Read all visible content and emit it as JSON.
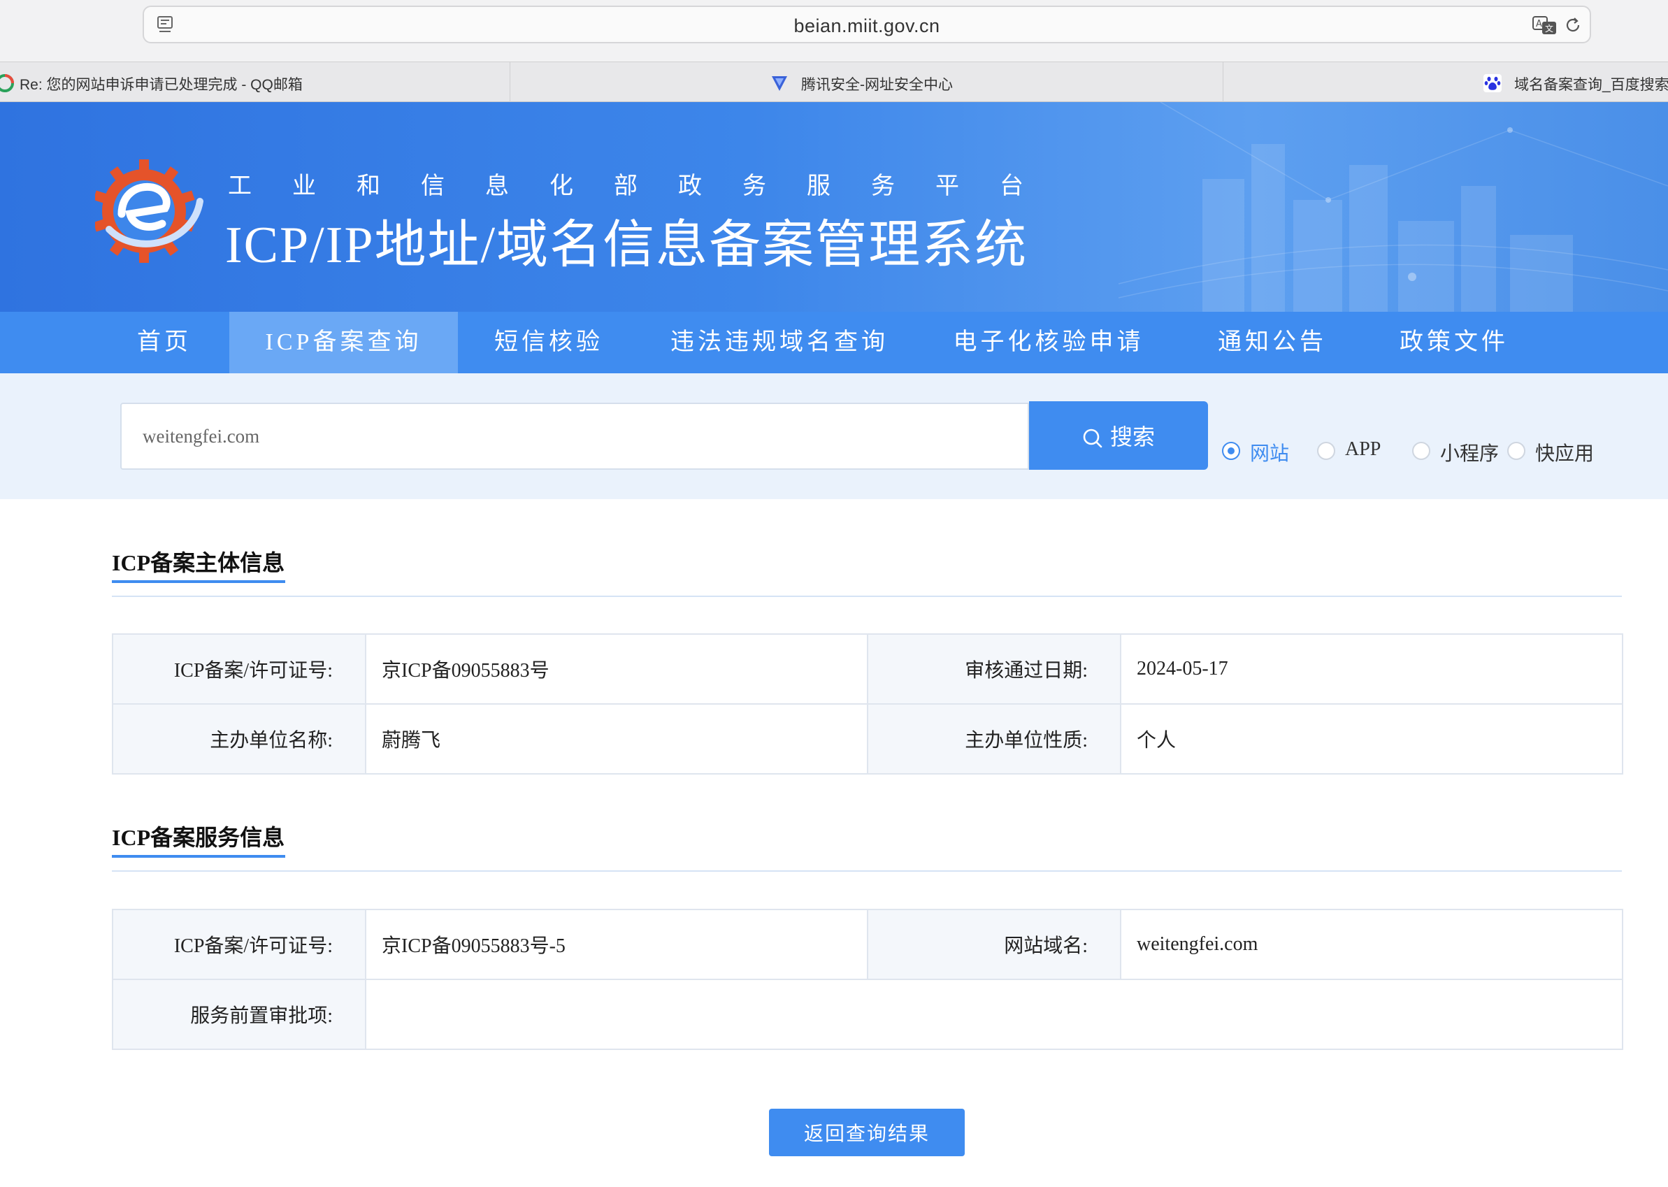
{
  "browser": {
    "address": "beian.miit.gov.cn",
    "tabs": [
      {
        "label": "Re: 您的网站申诉申请已处理完成 - QQ邮箱"
      },
      {
        "label": "腾讯安全-网址安全中心"
      },
      {
        "label": "域名备案查询_百度搜索"
      }
    ]
  },
  "header": {
    "ministry": "工业和信息化部政务服务平台",
    "system": "ICP/IP地址/域名信息备案管理系统"
  },
  "nav": {
    "items": [
      {
        "label": "首页"
      },
      {
        "label": "ICP备案查询"
      },
      {
        "label": "短信核验"
      },
      {
        "label": "违法违规域名查询"
      },
      {
        "label": "电子化核验申请"
      },
      {
        "label": "通知公告"
      },
      {
        "label": "政策文件"
      }
    ],
    "active_index": 1
  },
  "search": {
    "value": "weitengfei.com",
    "button_label": "搜索",
    "types": [
      {
        "label": "网站",
        "checked": true
      },
      {
        "label": "APP",
        "checked": false
      },
      {
        "label": "小程序",
        "checked": false
      },
      {
        "label": "快应用",
        "checked": false
      }
    ]
  },
  "subject_section": {
    "title": "ICP备案主体信息",
    "rows": [
      {
        "label1": "ICP备案/许可证号:",
        "value1": "京ICP备09055883号",
        "label2": "审核通过日期:",
        "value2": "2024-05-17"
      },
      {
        "label1": "主办单位名称:",
        "value1": "蔚腾飞",
        "label2": "主办单位性质:",
        "value2": "个人"
      }
    ]
  },
  "service_section": {
    "title": "ICP备案服务信息",
    "row1": {
      "label1": "ICP备案/许可证号:",
      "value1": "京ICP备09055883号-5",
      "label2": "网站域名:",
      "value2": "weitengfei.com"
    },
    "row2": {
      "label": "服务前置审批项:",
      "value": ""
    }
  },
  "actions": {
    "back_label": "返回查询结果"
  },
  "colors": {
    "primary": "#3f8cf0",
    "nav_active": "#6aa8f5",
    "search_bg": "#eaf2fc",
    "label_bg": "#f4f7fb"
  }
}
